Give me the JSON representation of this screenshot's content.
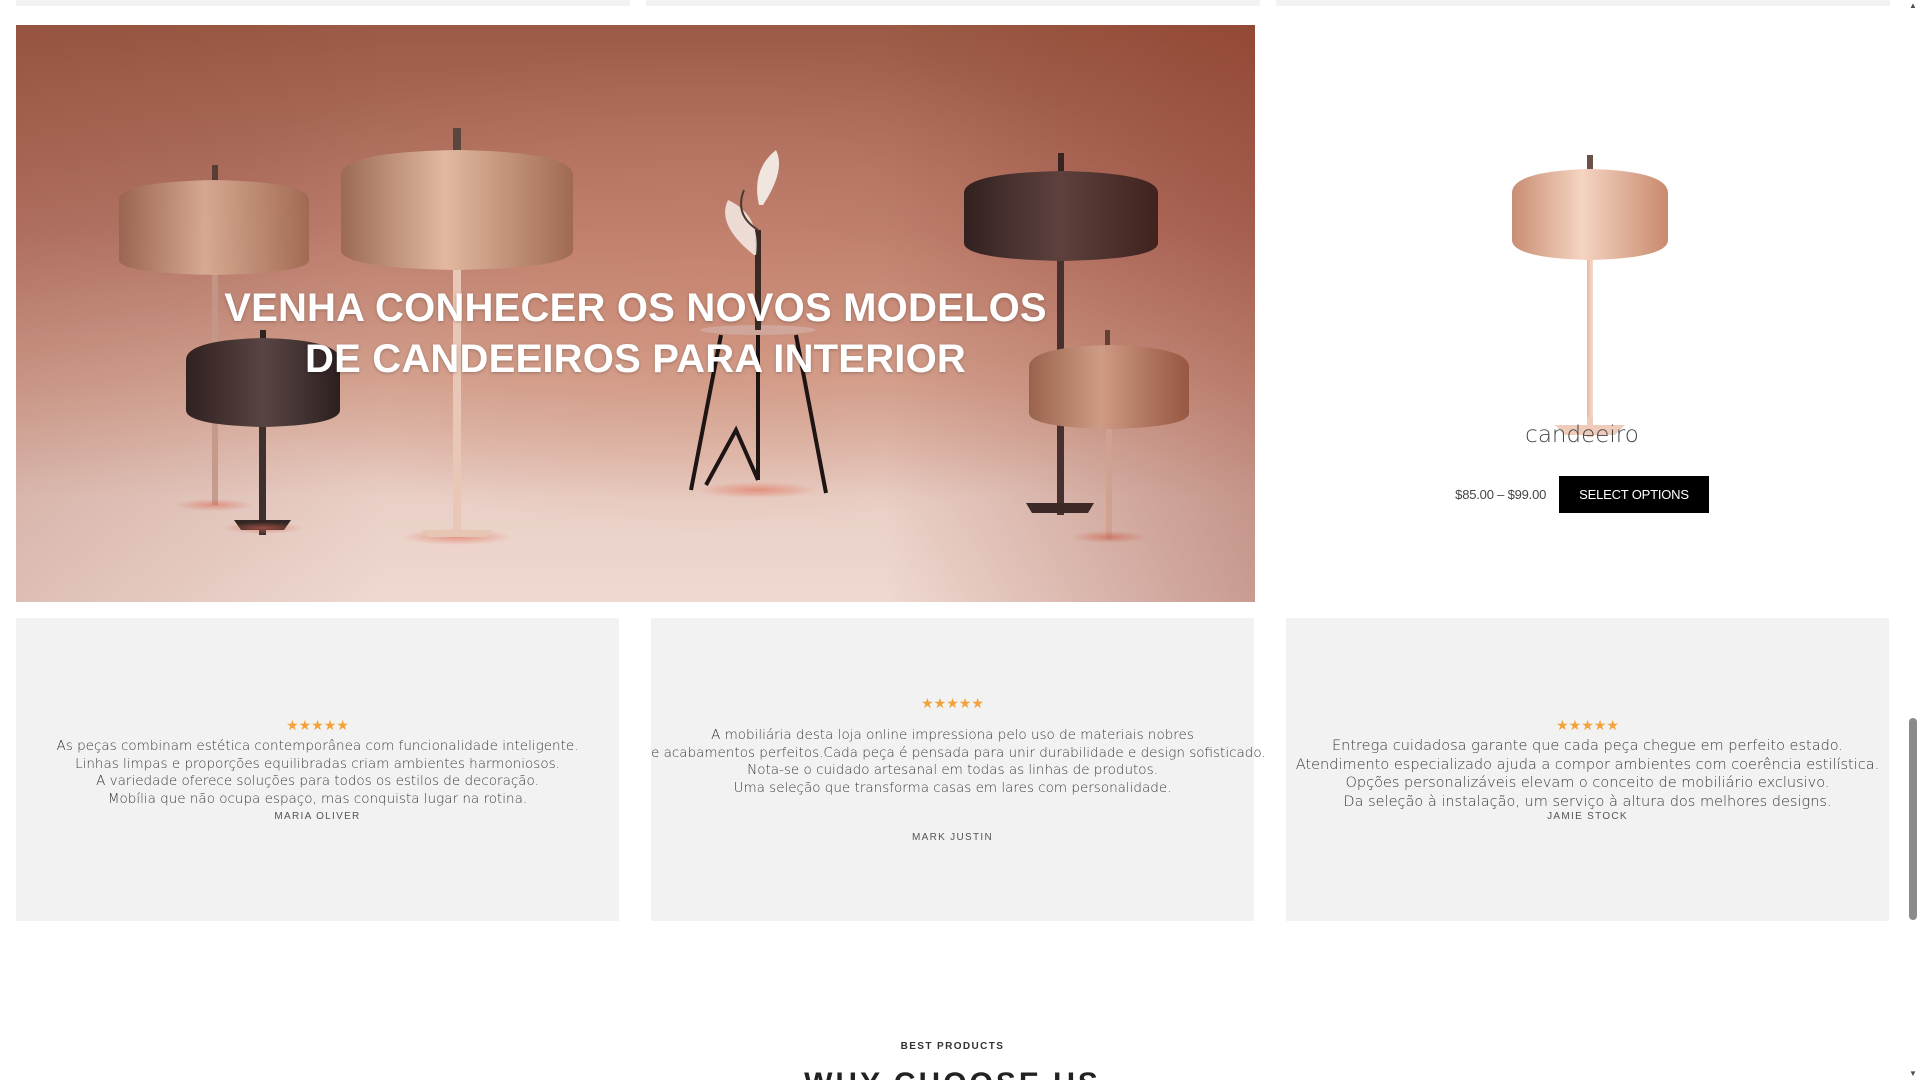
{
  "hero": {
    "title_line1": "VENHA CONHECER OS NOVOS MODELOS",
    "title_line2": "DE CANDEEIROS PARA INTERIOR"
  },
  "product": {
    "name": "candeeiro",
    "price": "$85.00 – $99.00",
    "button_label": "SELECT OPTIONS"
  },
  "testimonials": [
    {
      "stars": "★★★★★",
      "lines": [
        "As peças combinam estética contemporânea com funcionalidade inteligente.",
        "Linhas limpas e proporções equilibradas criam ambientes harmoniosos.",
        "A variedade oferece soluções para todos os estilos de decoração.",
        "Mobília que não ocupa espaço, mas conquista lugar na rotina."
      ],
      "author": "MARIA OLIVER"
    },
    {
      "stars": "★★★★★",
      "lines": [
        "A mobiliária desta loja online impressiona pelo uso de materiais nobres",
        "e acabamentos perfeitos.Cada peça é pensada para unir durabilidade e design sofisticado.",
        "Nota-se o cuidado artesanal em todas as linhas de produtos.",
        "Uma seleção que transforma casas em lares com personalidade."
      ],
      "author": "MARK JUSTIN"
    },
    {
      "stars": "★★★★★",
      "lines": [
        "Entrega cuidadosa garante que cada peça chegue em perfeito estado.",
        "Atendimento especializado ajuda a compor ambientes com coerência estilística.",
        "Opções personalizáveis elevam o conceito de mobiliário exclusivo.",
        "Da seleção à instalação, um serviço à altura dos melhores designs."
      ],
      "author": "JAMIE STOCK"
    }
  ],
  "best_products": {
    "eyebrow": "BEST PRODUCTS",
    "heading": "WHY CHOOSE US"
  },
  "scrollbar": {
    "up_icon": "▲",
    "down_icon": "▼"
  },
  "colors": {
    "star": "#f3a23a",
    "button_bg": "#000000",
    "card_bg": "#f1f2f1"
  }
}
